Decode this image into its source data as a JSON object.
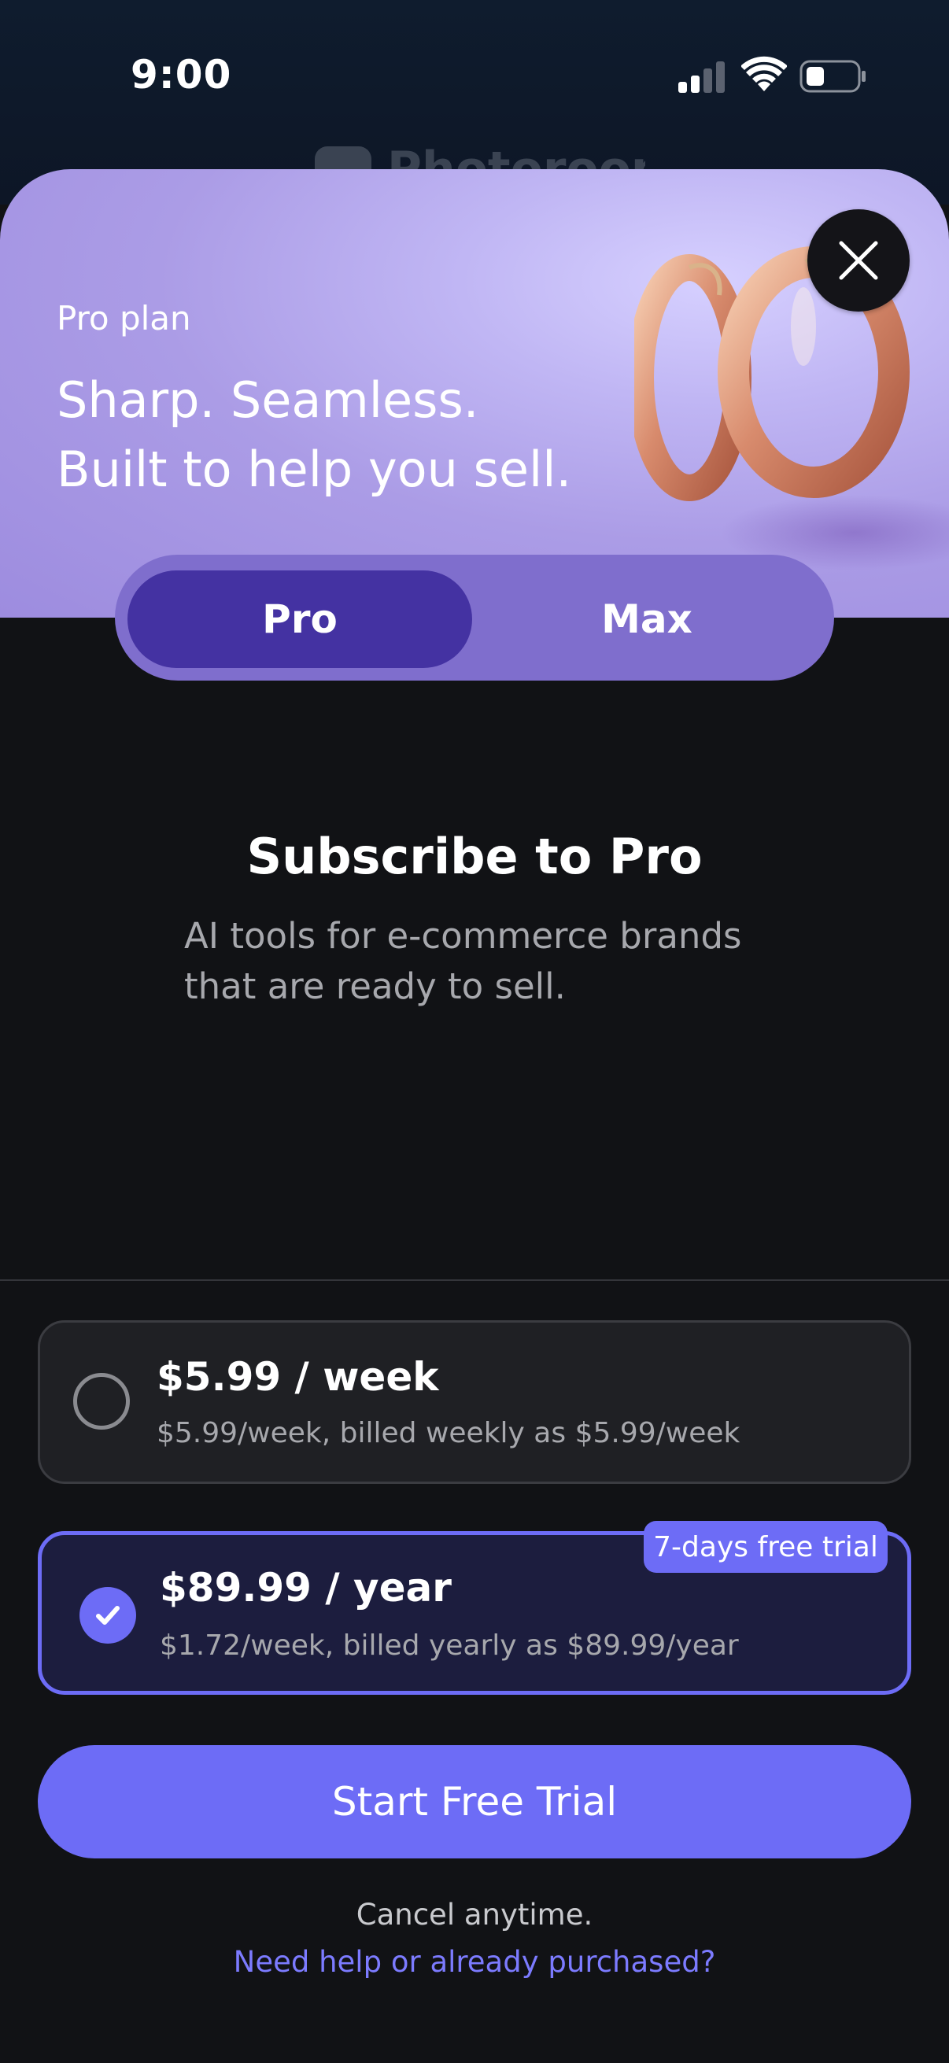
{
  "status_bar": {
    "time": "9:00",
    "signal_icon": "cellular-signal-icon",
    "wifi_icon": "wifi-icon",
    "battery_icon": "battery-icon"
  },
  "background": {
    "app_name": "Photoroom"
  },
  "hero": {
    "plan_label": "Pro plan",
    "title_line1": "Sharp. Seamless.",
    "title_line2": "Built to help you sell.",
    "close_icon": "close-icon",
    "image": "rose-gold-hoop-earrings"
  },
  "toggle": {
    "options": [
      "Pro",
      "Max"
    ],
    "selected": "Pro"
  },
  "main": {
    "title": "Subscribe to Pro",
    "description": "AI tools for e-commerce brands that are ready to sell."
  },
  "plans": [
    {
      "price": "$5.99 / week",
      "detail": "$5.99/week, billed weekly as $5.99/week",
      "selected": false
    },
    {
      "price": "$89.99 / year",
      "detail": "$1.72/week, billed yearly as $89.99/year",
      "badge": "7-days free trial",
      "selected": true
    }
  ],
  "cta": {
    "label": "Start Free Trial"
  },
  "footer": {
    "cancel_text": "Cancel anytime.",
    "help_link": "Need help or already purchased?"
  },
  "colors": {
    "accent": "#6d6cf6",
    "toggle_bg": "#7f6ecd",
    "toggle_selected": "#4432a2",
    "background": "#111215"
  }
}
